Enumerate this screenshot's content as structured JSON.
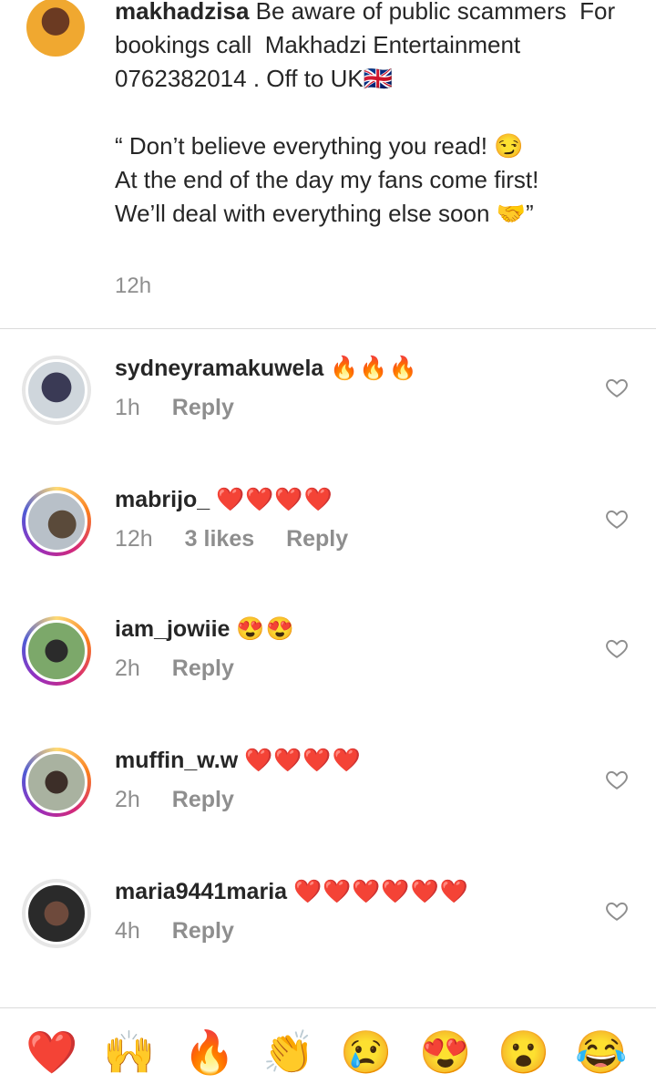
{
  "caption": {
    "username": "makhadzisa",
    "text": " Be aware of public scammers  For bookings call  Makhadzi Entertainment  0762382014 . Off to UK🇬🇧\n\n“ Don’t believe everything you read! 😏\nAt the end of the day my fans come first!\nWe’ll deal with everything else soon 🤝”",
    "time": "12h"
  },
  "comments": [
    {
      "username": "sydneyramakuwela",
      "emoji": "🔥🔥🔥",
      "time": "1h",
      "likes": "",
      "reply": "Reply"
    },
    {
      "username": "mabrijo_",
      "emoji": "❤️❤️❤️❤️",
      "time": "12h",
      "likes": "3 likes",
      "reply": "Reply"
    },
    {
      "username": "iam_jowiie",
      "emoji": "😍😍",
      "time": "2h",
      "likes": "",
      "reply": "Reply"
    },
    {
      "username": "muffin_w.w",
      "emoji": "❤️❤️❤️❤️",
      "time": "2h",
      "likes": "",
      "reply": "Reply"
    },
    {
      "username": "maria9441maria",
      "emoji": "❤️❤️❤️❤️❤️❤️",
      "time": "4h",
      "likes": "",
      "reply": "Reply"
    }
  ],
  "reactions": [
    "❤️",
    "🙌",
    "🔥",
    "👏",
    "😢",
    "😍",
    "😮",
    "😂"
  ],
  "colors": {
    "text": "#262626",
    "secondary": "#8e8e8e",
    "divider": "#dbdbdb",
    "heart": "#ed4956"
  }
}
